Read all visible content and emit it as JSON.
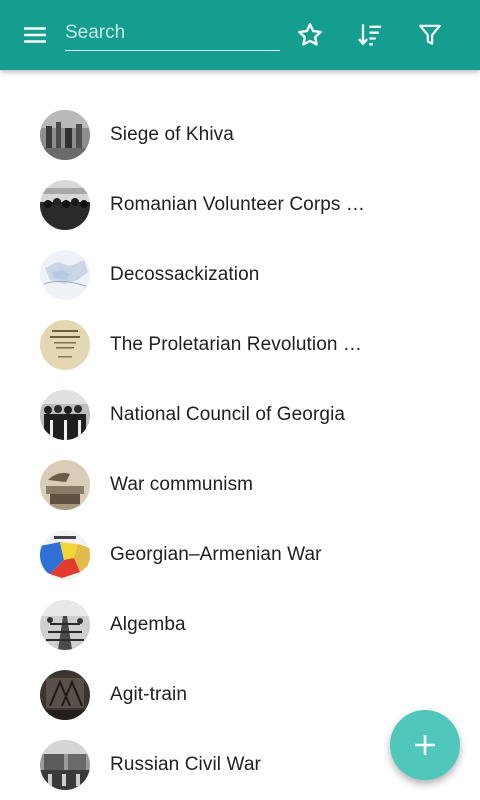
{
  "theme": {
    "accent": "#149e8f",
    "fab": "#4fc8bb",
    "icon_color": "#ffffff"
  },
  "toolbar": {
    "menu_icon": "menu-icon",
    "search_placeholder": "Search",
    "search_value": "",
    "favorites_icon": "star-outline-icon",
    "sort_icon": "sort-icon",
    "filter_icon": "filter-icon"
  },
  "articles": [
    {
      "title": "Siege of Khiva"
    },
    {
      "title": "Romanian Volunteer Corps …"
    },
    {
      "title": "Decossackization"
    },
    {
      "title": "The Proletarian Revolution …"
    },
    {
      "title": "National Council of Georgia"
    },
    {
      "title": "War communism"
    },
    {
      "title": "Georgian–Armenian War"
    },
    {
      "title": "Algemba"
    },
    {
      "title": "Agit-train"
    },
    {
      "title": "Russian Civil War"
    }
  ],
  "fab": {
    "icon": "plus-icon"
  }
}
